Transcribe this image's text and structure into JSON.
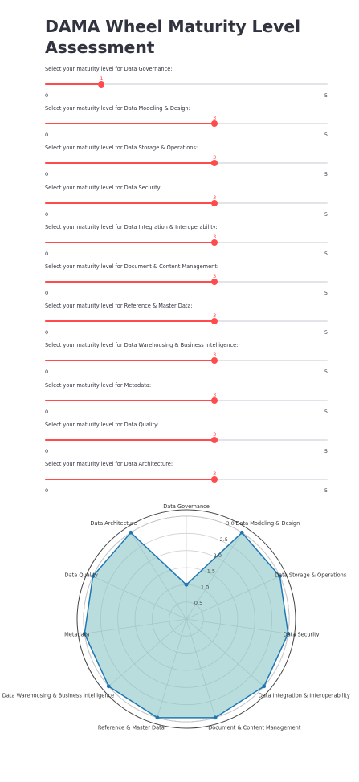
{
  "title": "DAMA Wheel Maturity Level Assessment",
  "slider_range": {
    "min": 0,
    "max": 5
  },
  "sliders": [
    {
      "label": "Select your maturity level for Data Governance:",
      "value": 1,
      "min_label": "0",
      "max_label": "5"
    },
    {
      "label": "Select your maturity level for Data Modeling & Design:",
      "value": 3,
      "min_label": "0",
      "max_label": "5"
    },
    {
      "label": "Select your maturity level for Data Storage & Operations:",
      "value": 3,
      "min_label": "0",
      "max_label": "5"
    },
    {
      "label": "Select your maturity level for Data Security:",
      "value": 3,
      "min_label": "0",
      "max_label": "5"
    },
    {
      "label": "Select your maturity level for Data Integration & Interoperability:",
      "value": 3,
      "min_label": "0",
      "max_label": "5"
    },
    {
      "label": "Select your maturity level for Document & Content Management:",
      "value": 3,
      "min_label": "0",
      "max_label": "5"
    },
    {
      "label": "Select your maturity level for Reference & Master Data:",
      "value": 3,
      "min_label": "0",
      "max_label": "5"
    },
    {
      "label": "Select your maturity level for Data Warehousing & Business Intelligence:",
      "value": 3,
      "min_label": "0",
      "max_label": "5"
    },
    {
      "label": "Select your maturity level for Metadata:",
      "value": 3,
      "min_label": "0",
      "max_label": "5"
    },
    {
      "label": "Select your maturity level for Data Quality:",
      "value": 3,
      "min_label": "0",
      "max_label": "5"
    },
    {
      "label": "Select your maturity level for Data Architecture:",
      "value": 3,
      "min_label": "0",
      "max_label": "5"
    }
  ],
  "colors": {
    "accent": "#ff4b4b",
    "track": "#e3e4ea",
    "radar_line": "#1f77b4",
    "radar_fill": "#7fbfc0"
  },
  "chart_data": {
    "type": "radar",
    "categories": [
      "Data Governance",
      "Data Modeling & Design",
      "Data Storage & Operations",
      "Data Security",
      "Data Integration & Interoperability",
      "Document & Content Management",
      "Reference & Master Data",
      "Data Warehousing & Business Intelligence",
      "Metadata",
      "Data Quality",
      "Data Architecture"
    ],
    "values": [
      1,
      3,
      3,
      3,
      3,
      3,
      3,
      3,
      3,
      3,
      3
    ],
    "radial_range": [
      0,
      3
    ],
    "radial_ticks": [
      "0.5",
      "1.0",
      "1.5",
      "2.0",
      "2.5",
      "3.0"
    ],
    "grid": true,
    "title": ""
  }
}
